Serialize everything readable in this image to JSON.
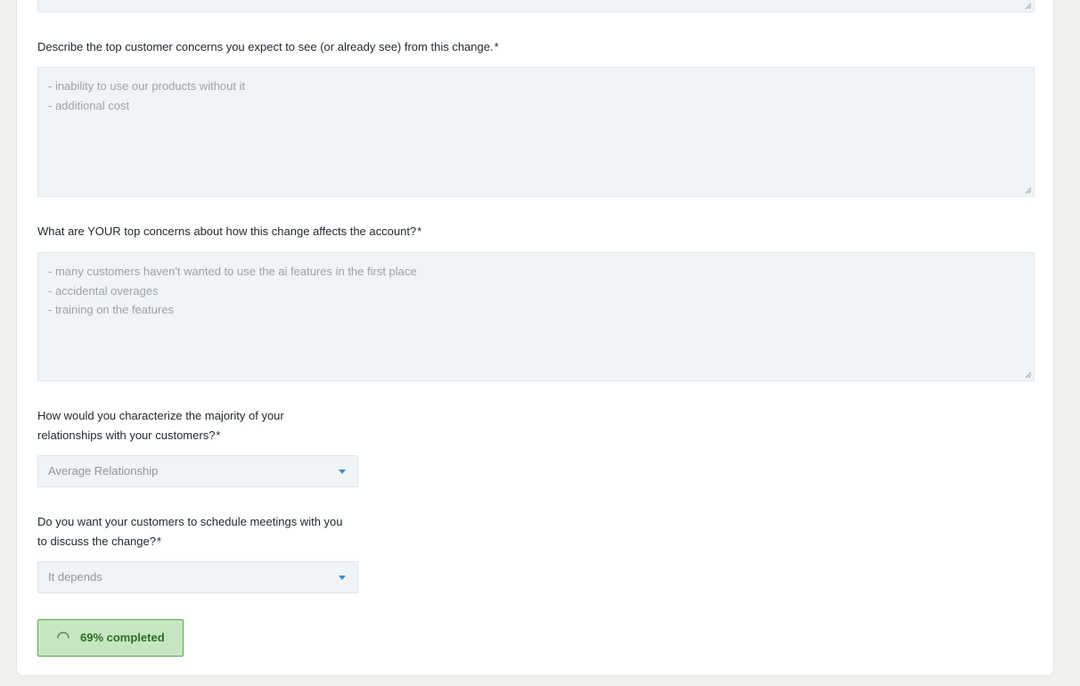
{
  "form": {
    "top_textarea": {},
    "customer_concerns": {
      "label": "Describe the top customer concerns you expect to see (or already see) from this change.",
      "required_mark": "*",
      "lines": [
        "- inability to use our products without it",
        "- additional cost"
      ]
    },
    "your_concerns": {
      "label": "What are YOUR top concerns about how this change affects the account?",
      "required_mark": "*",
      "lines": [
        "- many customers haven't wanted to use the ai features in the first place",
        "- accidental overages",
        "- training on the features"
      ]
    },
    "relationships": {
      "label_line1": "How would you characterize the majority of your",
      "label_line2": "relationships with your customers?",
      "required_mark": "*",
      "selected": "Average Relationship"
    },
    "meetings": {
      "label_line1": "Do you want your customers to schedule meetings with you",
      "label_line2": "to discuss the change?",
      "required_mark": "*",
      "selected": "It depends"
    },
    "progress": {
      "label": "69% completed",
      "percent": 69
    }
  },
  "icons": {
    "caret": "chevron-down-icon",
    "spinner": "spinner-icon",
    "resize": "resize-grip-icon"
  },
  "colors": {
    "accent": "#3a8bc2",
    "progress_bg": "#c6e6c1",
    "progress_border": "#57a84f",
    "progress_text": "#2a6e23",
    "field_bg": "#f0f4f7"
  }
}
